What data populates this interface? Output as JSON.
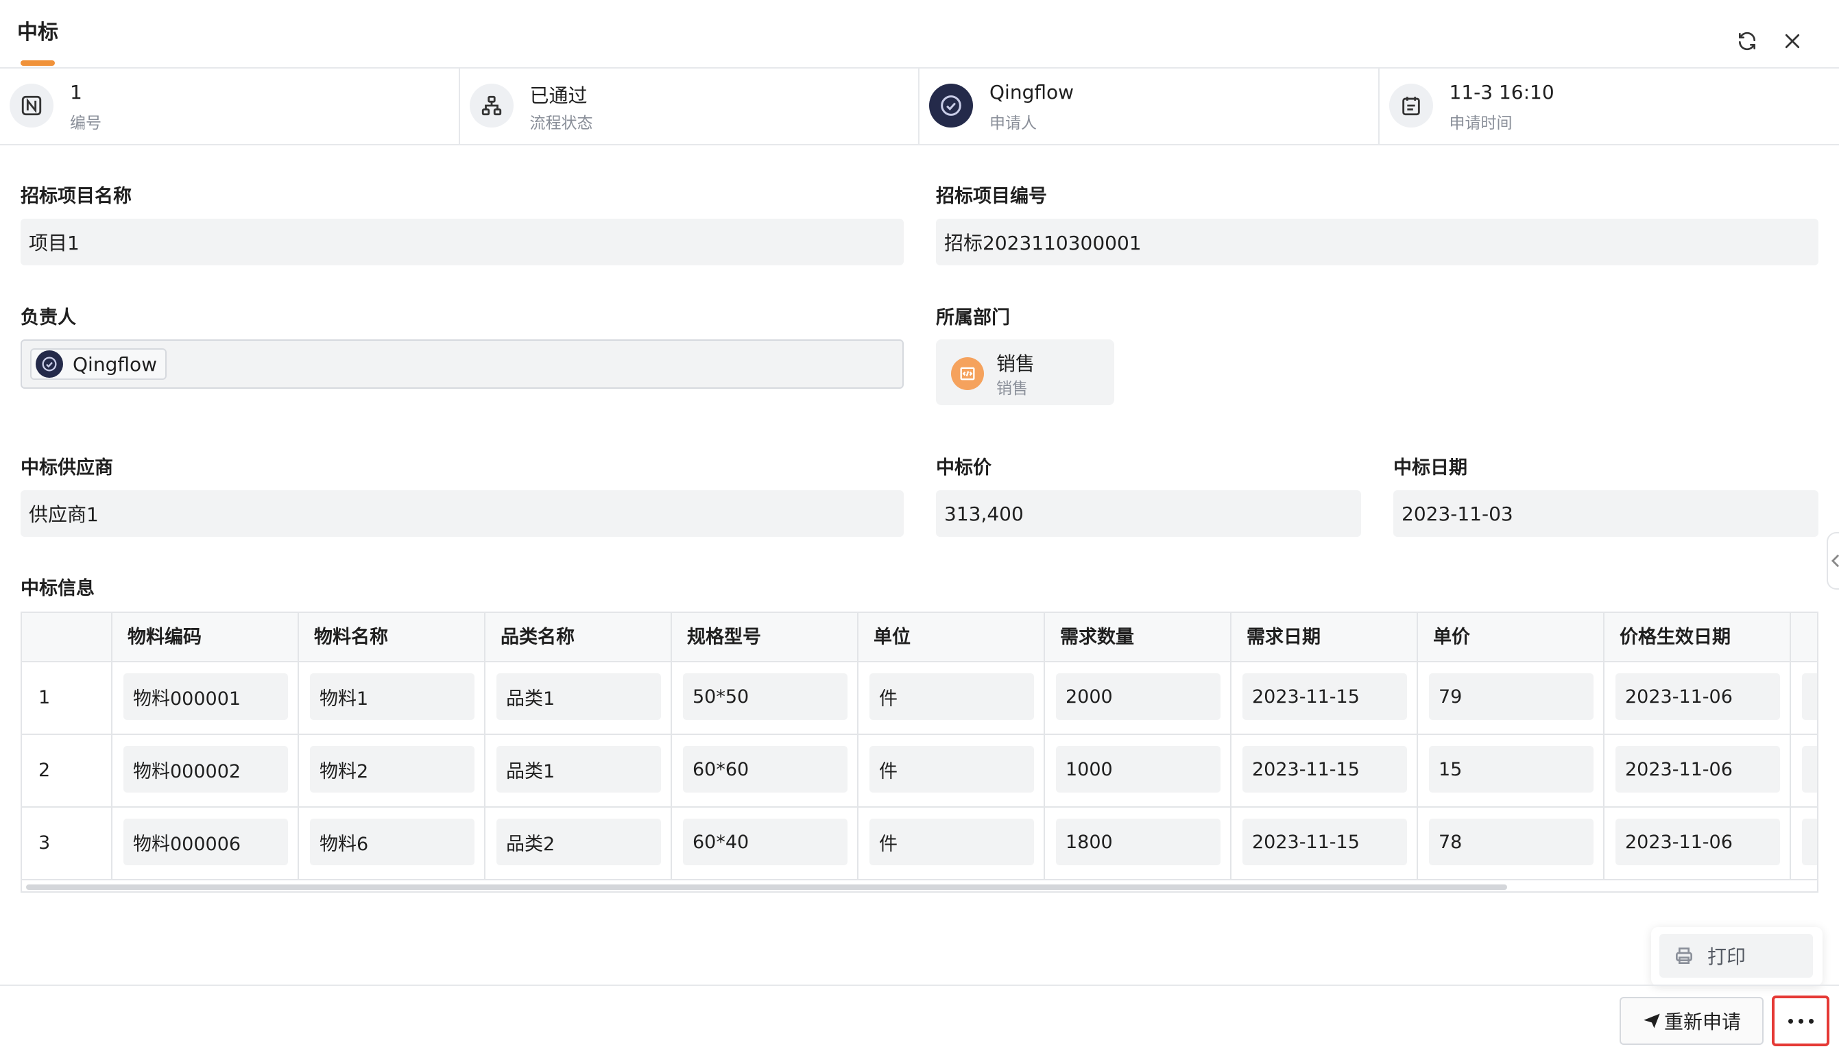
{
  "header": {
    "title": "中标",
    "accent_color": "#f0923a",
    "icons": [
      "refresh-icon",
      "close-icon"
    ]
  },
  "summary": [
    {
      "value": "1",
      "label": "编号",
      "icon": "n-badge-icon"
    },
    {
      "value": "已通过",
      "label": "流程状态",
      "icon": "workflow-icon"
    },
    {
      "value": "Qingflow",
      "label": "申请人",
      "icon": "user-avatar-icon"
    },
    {
      "value": "11-3 16:10",
      "label": "申请时间",
      "icon": "calendar-icon"
    }
  ],
  "form": {
    "project_name": {
      "label": "招标项目名称",
      "value": "项目1"
    },
    "project_code": {
      "label": "招标项目编号",
      "value": "招标2023110300001"
    },
    "owner": {
      "label": "负责人",
      "value": "Qingflow"
    },
    "department": {
      "label": "所属部门",
      "name": "销售",
      "sub": "销售"
    },
    "supplier": {
      "label": "中标供应商",
      "value": "供应商1"
    },
    "price": {
      "label": "中标价",
      "value": "313,400"
    },
    "date": {
      "label": "中标日期",
      "value": "2023-11-03"
    }
  },
  "table": {
    "title": "中标信息",
    "columns": [
      "物料编码",
      "物料名称",
      "品类名称",
      "规格型号",
      "单位",
      "需求数量",
      "需求日期",
      "单价",
      "价格生效日期"
    ],
    "rows": [
      {
        "index": "1",
        "cells": [
          "物料000001",
          "物料1",
          "品类1",
          "50*50",
          "件",
          "2000",
          "2023-11-15",
          "79",
          "2023-11-06"
        ]
      },
      {
        "index": "2",
        "cells": [
          "物料000002",
          "物料2",
          "品类1",
          "60*60",
          "件",
          "1000",
          "2023-11-15",
          "15",
          "2023-11-06"
        ]
      },
      {
        "index": "3",
        "cells": [
          "物料000006",
          "物料6",
          "品类2",
          "60*40",
          "件",
          "1800",
          "2023-11-15",
          "78",
          "2023-11-06"
        ]
      }
    ]
  },
  "footer": {
    "print_label": "打印",
    "reapply_label": "重新申请",
    "more_highlight_color": "#e53935"
  }
}
